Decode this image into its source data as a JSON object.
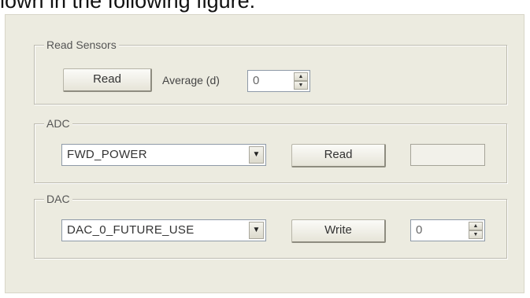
{
  "caption": "lown in the following figure.",
  "read_sensors": {
    "group_label": "Read Sensors",
    "read_button": "Read",
    "average_label": "Average (d)",
    "average_value": "0"
  },
  "adc": {
    "group_label": "ADC",
    "channel_selected": "FWD_POWER",
    "read_button": "Read",
    "result_value": ""
  },
  "dac": {
    "group_label": "DAC",
    "channel_selected": "DAC_0_FUTURE_USE",
    "write_button": "Write",
    "value": "0"
  },
  "icons": {
    "dropdown": "chevron-down-icon",
    "spin_up": "arrow-up-icon",
    "spin_down": "arrow-down-icon"
  },
  "colors": {
    "dialog_background": "#ecebe0",
    "group_border": "#bdbbb0"
  }
}
